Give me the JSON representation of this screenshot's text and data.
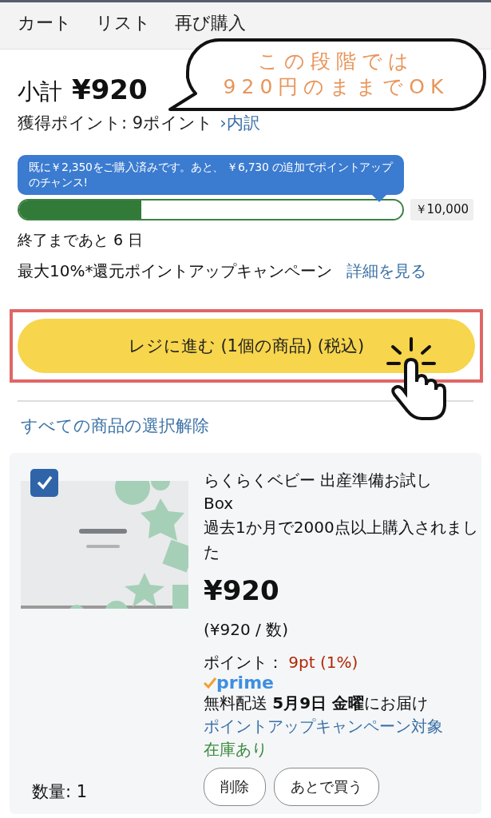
{
  "tabs": [
    {
      "label": "カート",
      "selected": false
    },
    {
      "label": "リスト",
      "selected": false
    },
    {
      "label": "再び購入",
      "selected": false
    }
  ],
  "callout": {
    "lines": [
      "この段階では",
      "920円のままでOK"
    ]
  },
  "subtotal": {
    "label": "小計",
    "amount": "¥920"
  },
  "points": {
    "text": "獲得ポイント: 9ポイント",
    "link": "›内訳"
  },
  "campaign": {
    "tooltip": "既に￥2,350をご購入済みです。あと、 ￥6,730 の追加でポイントアップのチャンス!",
    "level": 0.32,
    "goal": "￥10,000",
    "remaining": "終了まであと 6 日",
    "title": "最大10%*還元ポイントアップキャンペーン",
    "link": "詳細を見る"
  },
  "checkout_button": "レジに進む (1個の商品) (税込)",
  "deselect_all": "すべての商品の選択解除",
  "item": {
    "checked": true,
    "image": {
      "kind": "picture"
    },
    "title": "らくらくベビー 出産準備お試しBox",
    "note": "過去1か月で2000点以上購入されました",
    "price": "¥920",
    "unit_price": "(¥920 / 数)",
    "points_label": "ポイント：",
    "points_value": "9pt (1%)",
    "prime": "prime",
    "delivery": "無料配送 **5月9日 金曜**にお届け",
    "campaign_link": "ポイントアップキャンペーン対象",
    "stock": "在庫あり",
    "quantity": "数量: 1",
    "buttons": [
      "削除",
      "あとで買う"
    ]
  }
}
